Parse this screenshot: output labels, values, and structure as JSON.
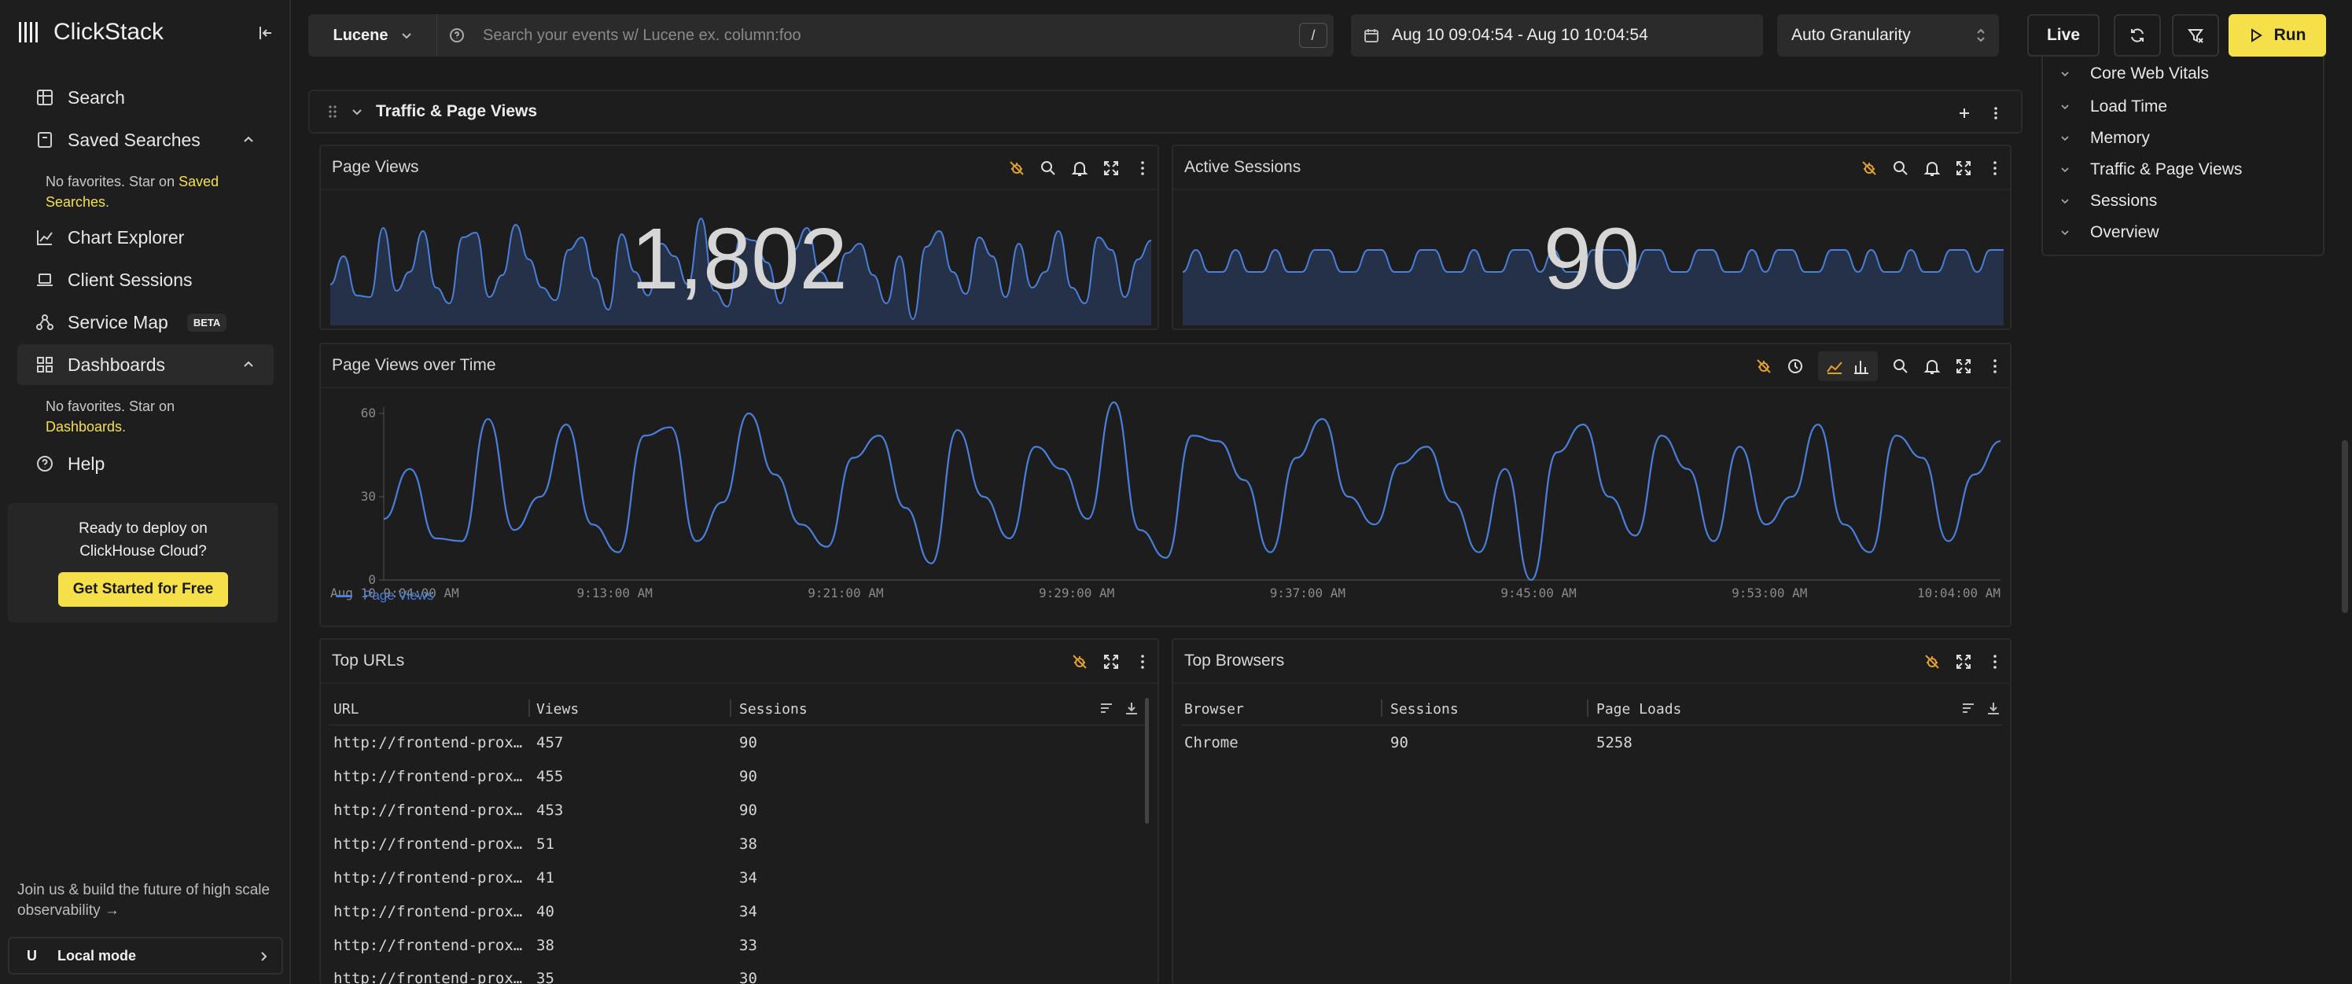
{
  "app": {
    "name": "ClickStack"
  },
  "sidebar": {
    "items": [
      {
        "label": "Search"
      },
      {
        "label": "Saved Searches"
      },
      {
        "label": "Chart Explorer"
      },
      {
        "label": "Client Sessions"
      },
      {
        "label": "Service Map",
        "badge": "BETA"
      },
      {
        "label": "Dashboards"
      },
      {
        "label": "Help"
      }
    ],
    "saved_note_prefix": "No favorites. Star on ",
    "saved_note_link": "Saved Searches",
    "dash_note_prefix": "No favorites. Star on ",
    "dash_note_link": "Dashboards",
    "period": ".",
    "promo_text": "Ready to deploy on ClickHouse Cloud?",
    "promo_button": "Get Started for Free",
    "join_text": "Join us & build the future of high scale observability →",
    "local_initial": "U",
    "local_label": "Local mode"
  },
  "topbar": {
    "query_lang": "Lucene",
    "search_placeholder": "Search your events w/ Lucene ex. column:foo",
    "slash": "/",
    "time_range": "Aug 10 09:04:54 - Aug 10 10:04:54",
    "granularity": "Auto Granularity",
    "live": "Live",
    "run": "Run"
  },
  "toc": {
    "items": [
      "Core Web Vitals",
      "Load Time",
      "Memory",
      "Traffic & Page Views",
      "Sessions",
      "Overview"
    ]
  },
  "section": {
    "title": "Traffic & Page Views"
  },
  "tiles": {
    "page_views": {
      "title": "Page Views",
      "value": "1,802"
    },
    "active_sessions": {
      "title": "Active Sessions",
      "value": "90"
    },
    "over_time": {
      "title": "Page Views over Time"
    },
    "top_urls": {
      "title": "Top URLs",
      "headers": [
        "URL",
        "Views",
        "Sessions"
      ],
      "rows": [
        [
          "http://frontend-prox…",
          "457",
          "90"
        ],
        [
          "http://frontend-prox…",
          "455",
          "90"
        ],
        [
          "http://frontend-prox…",
          "453",
          "90"
        ],
        [
          "http://frontend-prox…",
          "51",
          "38"
        ],
        [
          "http://frontend-prox…",
          "41",
          "34"
        ],
        [
          "http://frontend-prox…",
          "40",
          "34"
        ],
        [
          "http://frontend-prox…",
          "38",
          "33"
        ],
        [
          "http://frontend-prox…",
          "35",
          "30"
        ]
      ]
    },
    "top_browsers": {
      "title": "Top Browsers",
      "headers": [
        "Browser",
        "Sessions",
        "Page Loads"
      ],
      "rows": [
        [
          "Chrome",
          "90",
          "5258"
        ]
      ]
    }
  },
  "colors": {
    "accent": "#f5e04a",
    "line": "#4a7fdc",
    "warning_icon": "#e0a030"
  },
  "chart_data": {
    "type": "line",
    "title": "Page Views over Time",
    "xlabel": "",
    "ylabel": "",
    "ylim": [
      0,
      60
    ],
    "yticks": [
      0,
      30,
      60
    ],
    "xticks": [
      "Aug 10 9:04:00 AM",
      "9:13:00 AM",
      "9:21:00 AM",
      "9:29:00 AM",
      "9:37:00 AM",
      "9:45:00 AM",
      "9:53:00 AM",
      "10:04:00 AM"
    ],
    "legend_position": "bottom-left",
    "series": [
      {
        "name": "Page Views",
        "values": [
          22,
          40,
          15,
          14,
          58,
          18,
          30,
          56,
          20,
          10,
          52,
          55,
          14,
          28,
          60,
          38,
          20,
          12,
          44,
          52,
          26,
          6,
          54,
          30,
          15,
          48,
          40,
          22,
          64,
          18,
          8,
          52,
          50,
          36,
          10,
          44,
          58,
          30,
          20,
          42,
          48,
          28,
          10,
          40,
          0,
          46,
          56,
          30,
          16,
          52,
          40,
          14,
          48,
          20,
          30,
          56,
          20,
          10,
          52,
          44,
          14,
          38,
          50
        ]
      }
    ]
  }
}
